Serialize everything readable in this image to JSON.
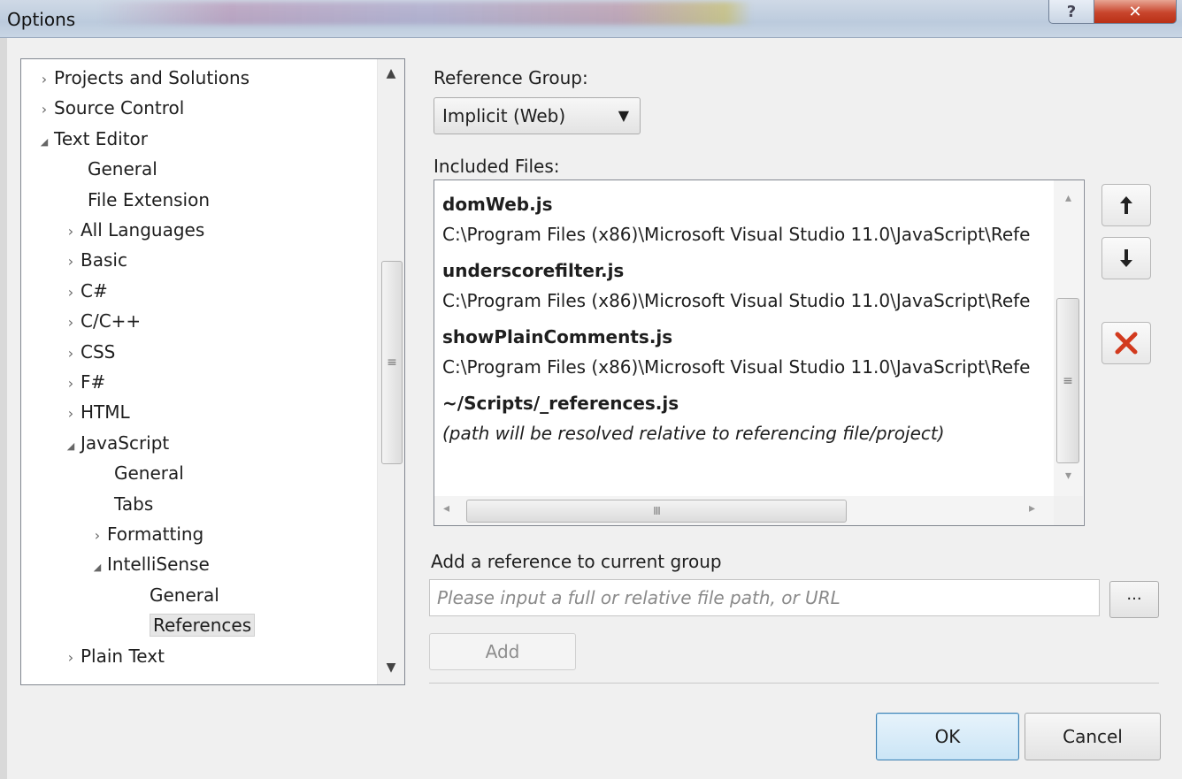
{
  "window": {
    "title": "Options"
  },
  "tree": {
    "items": [
      {
        "label": "Projects and Solutions",
        "expander": "›"
      },
      {
        "label": "Source Control",
        "expander": "›"
      },
      {
        "label": "Text Editor",
        "expander": "◢"
      },
      {
        "label": "General",
        "expander": ""
      },
      {
        "label": "File Extension",
        "expander": ""
      },
      {
        "label": "All Languages",
        "expander": "›"
      },
      {
        "label": "Basic",
        "expander": "›"
      },
      {
        "label": "C#",
        "expander": "›"
      },
      {
        "label": "C/C++",
        "expander": "›"
      },
      {
        "label": "CSS",
        "expander": "›"
      },
      {
        "label": "F#",
        "expander": "›"
      },
      {
        "label": "HTML",
        "expander": "›"
      },
      {
        "label": "JavaScript",
        "expander": "◢"
      },
      {
        "label": "General",
        "expander": ""
      },
      {
        "label": "Tabs",
        "expander": ""
      },
      {
        "label": "Formatting",
        "expander": "›"
      },
      {
        "label": "IntelliSense",
        "expander": "◢"
      },
      {
        "label": "General",
        "expander": ""
      },
      {
        "label": "References",
        "expander": "",
        "selected": true
      },
      {
        "label": "Plain Text",
        "expander": "›"
      }
    ]
  },
  "reference_group": {
    "label": "Reference Group:",
    "selected": "Implicit (Web)"
  },
  "included_files": {
    "label": "Included Files:",
    "items": [
      {
        "name": "domWeb.js",
        "path": "C:\\Program Files (x86)\\Microsoft Visual Studio 11.0\\JavaScript\\Refe"
      },
      {
        "name": "underscorefilter.js",
        "path": "C:\\Program Files (x86)\\Microsoft Visual Studio 11.0\\JavaScript\\Refe"
      },
      {
        "name": "showPlainComments.js",
        "path": "C:\\Program Files (x86)\\Microsoft Visual Studio 11.0\\JavaScript\\Refe"
      },
      {
        "name": "~/Scripts/_references.js",
        "path": "(path will be resolved relative to referencing file/project)"
      }
    ]
  },
  "add_reference": {
    "label": "Add a reference to current group",
    "placeholder": "Please input a full or relative file path, or URL",
    "browse_label": "...",
    "add_label": "Add"
  },
  "buttons": {
    "ok": "OK",
    "cancel": "Cancel"
  },
  "colors": {
    "delete_icon": "#d23a1e",
    "ok_border": "#3c7fb1"
  }
}
